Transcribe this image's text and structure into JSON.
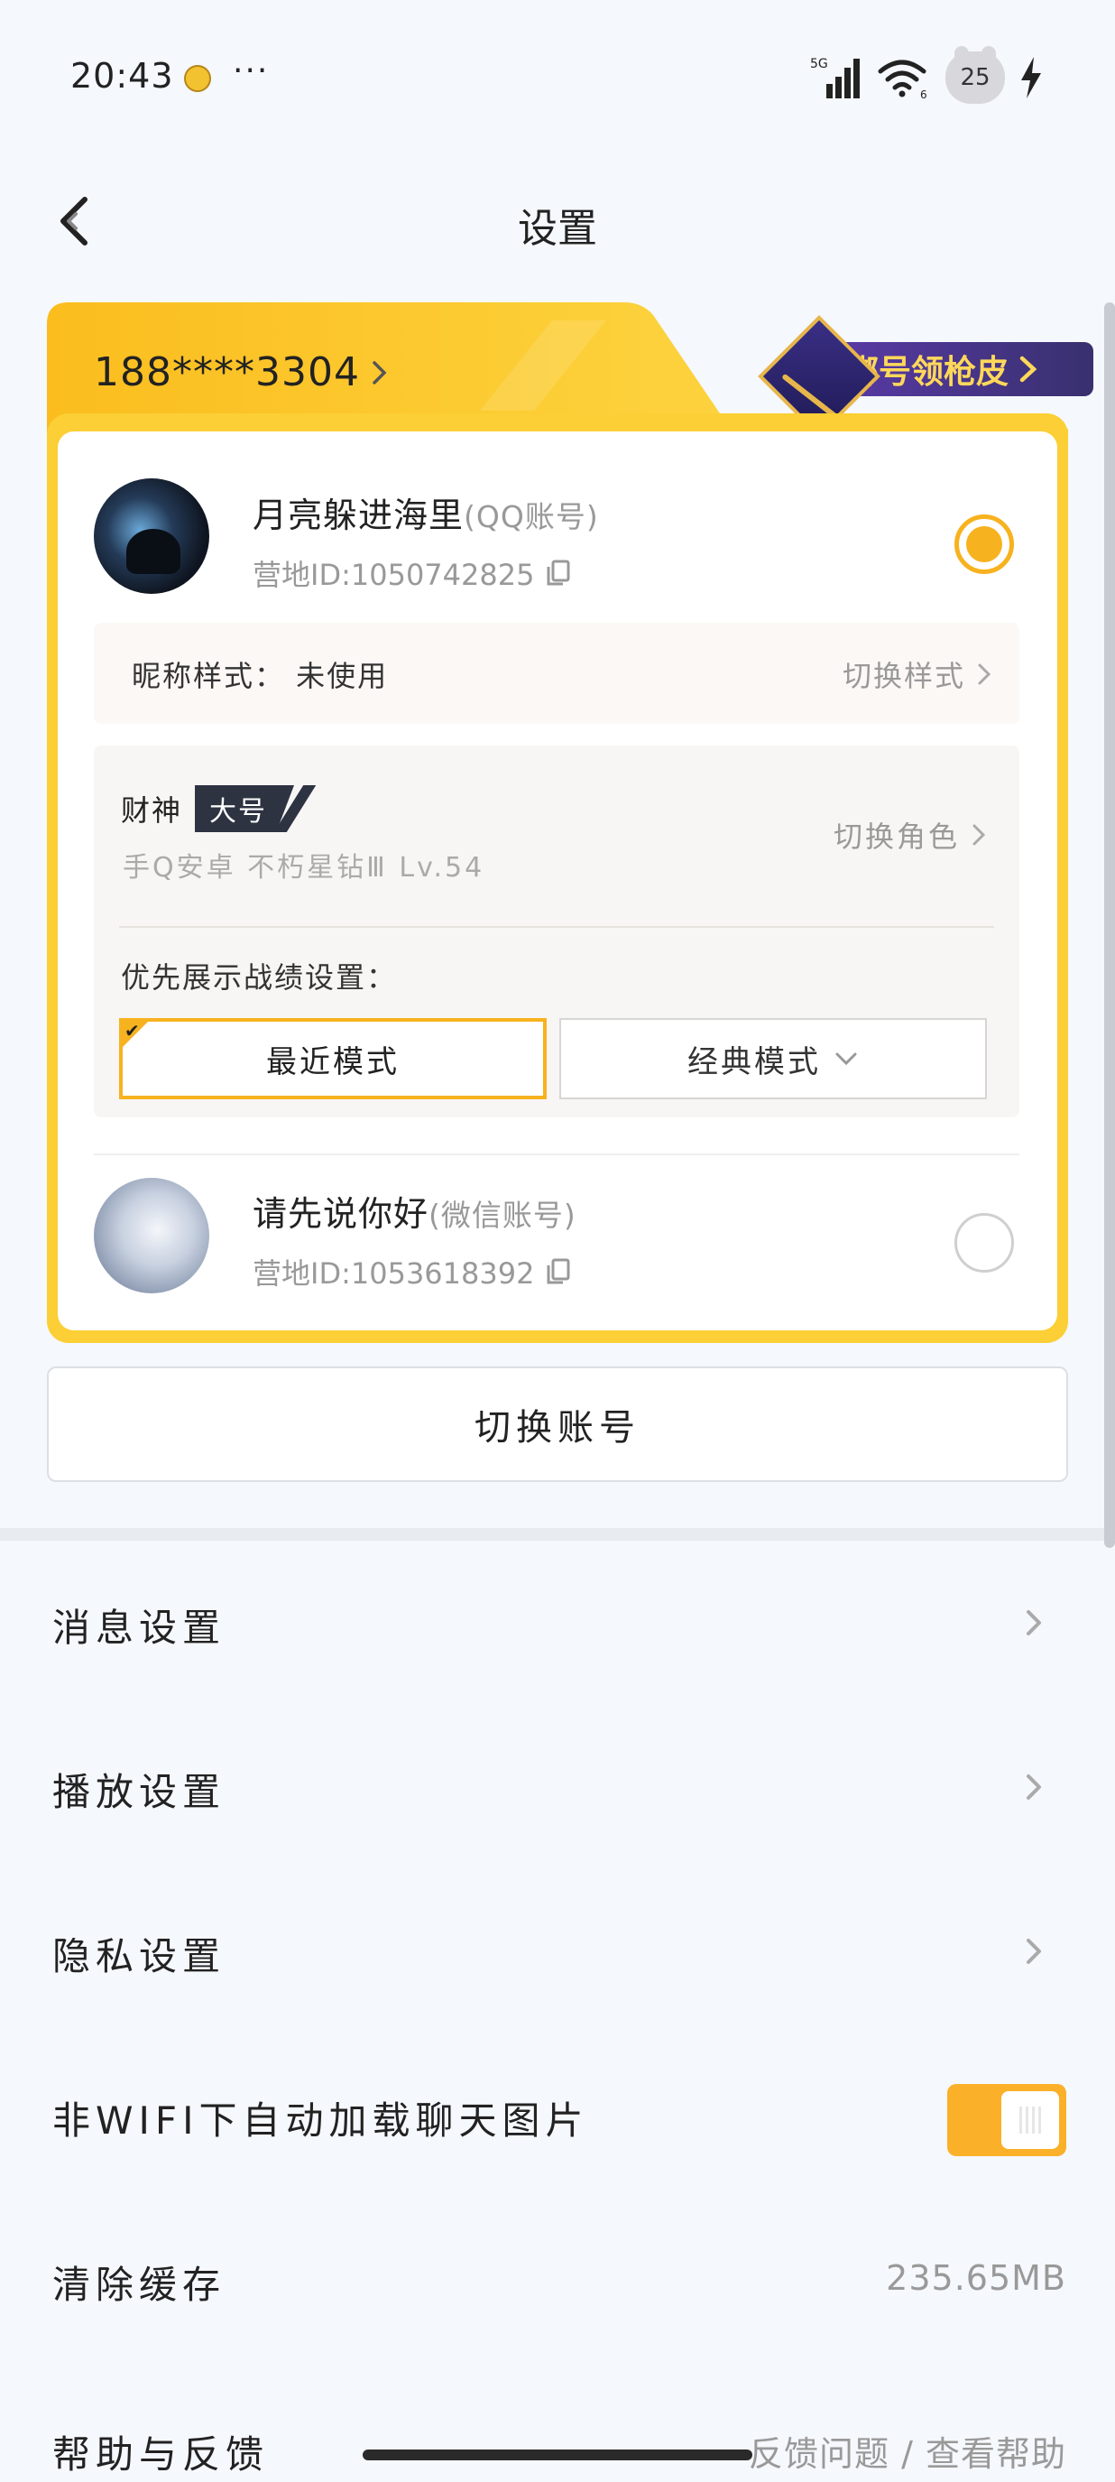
{
  "status_bar": {
    "time": "20:43",
    "dots": "···",
    "signal_label": "5G",
    "wifi_label": "6",
    "battery": "25",
    "icons": [
      "app-notification-icon",
      "signal-icon",
      "wifi-icon",
      "battery-icon",
      "charging-icon"
    ]
  },
  "header": {
    "title": "设置",
    "back_icon": "back-arrow-icon"
  },
  "account_card": {
    "phone": "188****3304",
    "promo_label": "绑号领枪皮",
    "accounts": [
      {
        "name": "月亮躲进海里",
        "type": "(QQ账号)",
        "camp_id": "营地ID:1050742825",
        "selected": true
      },
      {
        "name": "请先说你好",
        "type": "(微信账号)",
        "camp_id": "营地ID:1053618392",
        "selected": false
      }
    ],
    "nickname_style": {
      "label": "昵称样式：  未使用",
      "switch": "切换样式"
    },
    "role": {
      "name": "财神",
      "tag": "大号",
      "detail": "手Q安卓  不朽星钻Ⅲ  Lv.54",
      "switch": "切换角色",
      "pref_label": "优先展示战绩设置：",
      "modes": [
        "最近模式",
        "经典模式"
      ],
      "selected_mode": "最近模式"
    },
    "switch_account": "切换账号"
  },
  "settings": {
    "rows": [
      {
        "label": "消息设置"
      },
      {
        "label": "播放设置"
      },
      {
        "label": "隐私设置"
      },
      {
        "label": "非WIFI下自动加载聊天图片",
        "toggle": true
      },
      {
        "label": "清除缓存",
        "value": "235.65MB"
      },
      {
        "label": "帮助与反馈",
        "value": "反馈问题 / 查看帮助"
      }
    ]
  },
  "colors": {
    "accent": "#f7b21f",
    "card_frame": "#fbcf35",
    "promo_bg": "#4a3592",
    "promo_text": "#ffd85a"
  }
}
